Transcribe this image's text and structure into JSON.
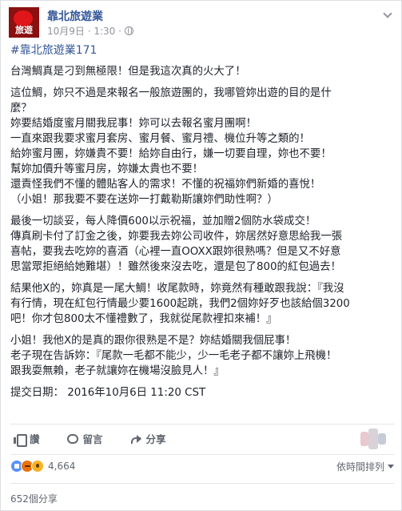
{
  "post": {
    "page_name": "靠北旅遊業",
    "avatar_text": "旅遊",
    "timestamp": "10月9日 · 1:30 ·",
    "hashtag": "#靠北旅遊業171",
    "paragraphs": [
      [
        "台灣鯛真是刁到無極限！但是我這次真的火大了！"
      ],
      [
        "這位鯛，妳只不過是來報名一般旅遊團的，我哪管妳出遊的目的是什",
        "麼？",
        "妳要結婚度蜜月關我屁事！妳可以去報名蜜月團啊！",
        "一直來跟我要求蜜月套房、蜜月餐、蜜月禮、機位升等之類的！",
        "給妳蜜月團，妳嫌貴不要！給妳自由行，嫌一切要自理，妳也不要！",
        "幫妳加價升等蜜月房，妳嫌太貴也不要！",
        "還責怪我們不懂的體貼客人的需求！不懂的祝福妳們新婚的喜悅！",
        "（小姐！那我要不要在送妳一打戴勒斯讓妳們助性啊？）"
      ],
      [
        "最後一切談妥，每人降價600以示祝福，並加贈2個防水袋成交！",
        "傳真刷卡付了訂金之後，妳要我去妳公司收件，妳居然好意思給我一張",
        "喜帖，要我去吃妳的喜酒（心裡一直OOXX跟妳很熟嗎？但是又不好意",
        "思當眾拒絕給她難堪）！雖然後來沒去吃，還是包了800的紅包過去！"
      ],
      [
        "結果他X的，妳真是一尾大鯛！收尾款時，妳竟然有種敢跟我說：『我沒",
        "有行情，現在紅包行情最少要1600起跳，我們2個妳好歹也該給個3200",
        "吧！你才包800太不懂禮數了，我就從尾款裡扣來補！』"
      ],
      [
        "小姐！我他X的是真的跟你很熟是不是？妳結婚關我個屁事！",
        "老子現在告訴妳：『尾款一毛都不能少，少一毛老子都不讓妳上飛機！",
        "跟我耍無賴，老子就讓妳在機場沒臉見人！』"
      ],
      [
        "提交日期： 2016年10月6日 11:20 CST"
      ]
    ]
  },
  "actions": {
    "like_label": "讚",
    "comment_label": "留言",
    "share_label": "分享"
  },
  "reactions": {
    "count": "4,664",
    "sort_label": "依時間排列"
  },
  "shares": {
    "label": "652個分享"
  }
}
